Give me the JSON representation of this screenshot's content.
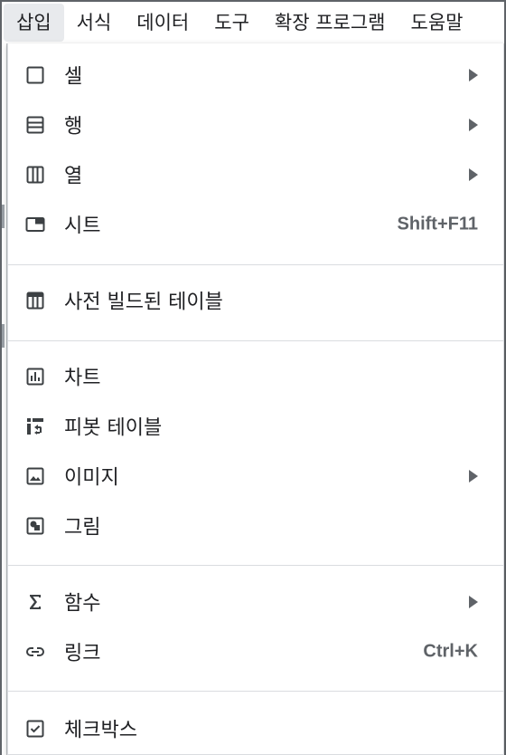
{
  "menubar": {
    "items": [
      "삽입",
      "서식",
      "데이터",
      "도구",
      "확장 프로그램",
      "도움말"
    ],
    "active_index": 0
  },
  "insert_menu": {
    "items": [
      {
        "label": "셀",
        "icon": "cell-icon",
        "submenu": true
      },
      {
        "label": "행",
        "icon": "rows-icon",
        "submenu": true
      },
      {
        "label": "열",
        "icon": "columns-icon",
        "submenu": true
      },
      {
        "label": "시트",
        "icon": "sheet-icon",
        "shortcut": "Shift+F11"
      },
      {
        "label": "사전 빌드된 테이블",
        "icon": "table-icon"
      },
      {
        "label": "차트",
        "icon": "chart-icon"
      },
      {
        "label": "피봇 테이블",
        "icon": "pivot-table-icon"
      },
      {
        "label": "이미지",
        "icon": "image-icon",
        "submenu": true
      },
      {
        "label": "그림",
        "icon": "drawing-icon"
      },
      {
        "label": "함수",
        "icon": "sigma-icon",
        "submenu": true
      },
      {
        "label": "링크",
        "icon": "link-icon",
        "shortcut": "Ctrl+K"
      },
      {
        "label": "체크박스",
        "icon": "checkbox-icon"
      }
    ]
  },
  "colors": {
    "text": "#202124",
    "icon": "#3c4043",
    "secondary": "#5f6368",
    "separator": "#dadce0",
    "active_menu_bg": "#e8eaed"
  }
}
